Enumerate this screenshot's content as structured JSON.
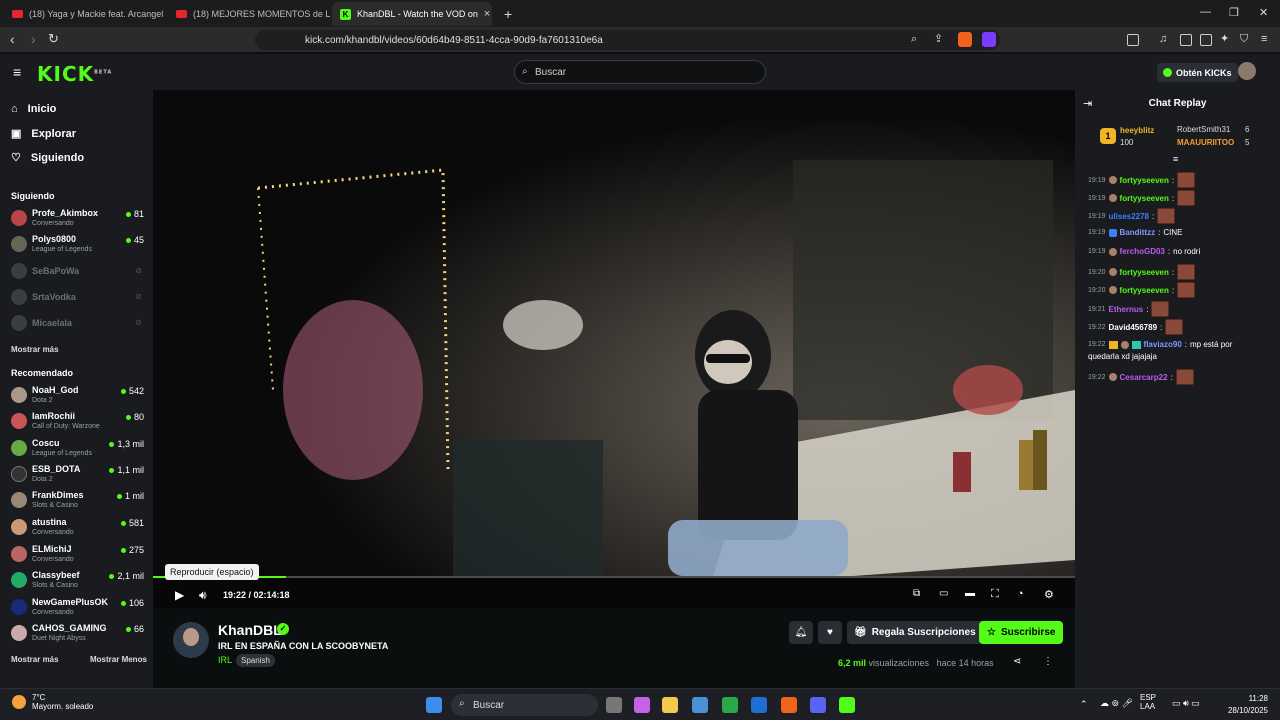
{
  "browser": {
    "tabs": [
      {
        "title": "(18) Yaga y Mackie feat. Arcangel y d",
        "active": false
      },
      {
        "title": "(18) MEJORES MOMENTOS de LA SC",
        "active": false
      },
      {
        "title": "KhanDBL - Watch the VOD on",
        "active": true
      }
    ],
    "url": "kick.com/khandbl/videos/60d64b49-8511-4cca-90d9-fa7601310e6a"
  },
  "header": {
    "logo": "KICK",
    "logo_beta": "BETA",
    "search_placeholder": "Buscar",
    "kicks_button": "Obtén KICKs"
  },
  "sidebar": {
    "nav": [
      {
        "label": "Inicio",
        "icon": "home-icon"
      },
      {
        "label": "Explorar",
        "icon": "compass-icon"
      },
      {
        "label": "Siguiendo",
        "icon": "heart-icon"
      }
    ],
    "following_title": "Siguiendo",
    "following": [
      {
        "name": "Profe_Akimbox",
        "category": "Conversando",
        "viewers": "81",
        "online": true
      },
      {
        "name": "Polys0800",
        "category": "League of Legends",
        "viewers": "45",
        "online": true
      },
      {
        "name": "SeBaPoWa",
        "online": false
      },
      {
        "name": "SrtaVodka",
        "online": false
      },
      {
        "name": "Micaelala",
        "online": false
      }
    ],
    "show_more": "Mostrar más",
    "recommended_title": "Recomendado",
    "recommended": [
      {
        "name": "NoaH_God",
        "category": "Dota 2",
        "viewers": "542"
      },
      {
        "name": "IamRochii",
        "category": "Call of Duty: Warzone",
        "viewers": "80"
      },
      {
        "name": "Coscu",
        "category": "League of Legends",
        "viewers": "1,3 mil"
      },
      {
        "name": "ESB_DOTA",
        "category": "Dota 2",
        "viewers": "1,1 mil"
      },
      {
        "name": "FrankDimes",
        "category": "Slots & Casino",
        "viewers": "1 mil"
      },
      {
        "name": "atustina",
        "category": "Conversando",
        "viewers": "581"
      },
      {
        "name": "ELMichiJ",
        "category": "Conversando",
        "viewers": "275"
      },
      {
        "name": "Classybeef",
        "category": "Slots & Casino",
        "viewers": "2,1 mil"
      },
      {
        "name": "NewGamePlusOK",
        "category": "Conversando",
        "viewers": "106"
      },
      {
        "name": "CAHOS_GAMING",
        "category": "Duet Night Abyss",
        "viewers": "66"
      }
    ],
    "show_more_2": "Mostrar más",
    "show_less": "Mostrar Menos"
  },
  "player": {
    "tooltip": "Reproducir (espacio)",
    "time": "19:22 / 02:14:18",
    "progress": 0.144
  },
  "stream": {
    "streamer": "KhanDBL",
    "title": "IRL EN ESPAÑA CON LA SCOOBYNETA",
    "category": "IRL",
    "language": "Spanish",
    "gift_button": "Regala Suscripciones",
    "subscribe_button": "Suscribirse",
    "views_count": "6,2 mil",
    "views_label": "visualizaciones",
    "time_ago": "hace 14 horas"
  },
  "chat": {
    "title": "Chat Replay",
    "top_gifter": {
      "rank": "1",
      "name": "heeyblitz",
      "amount": "100"
    },
    "gifters": [
      {
        "name": "RobertSmith31",
        "amount": "6"
      },
      {
        "name": "MAAUURIITOO",
        "amount": "5"
      }
    ],
    "messages": [
      {
        "time": "19:19",
        "user": "fortyyseeven",
        "text": "",
        "color": "#53fc18",
        "emote": true
      },
      {
        "time": "19:19",
        "user": "fortyyseeven",
        "text": "",
        "color": "#53fc18",
        "emote": true
      },
      {
        "time": "19:19",
        "user": "ulises2278",
        "text": "",
        "color": "#3b82f6",
        "emote": true
      },
      {
        "time": "19:19",
        "user": "Bandittzz",
        "text": "CINE",
        "color": "#7c9cff",
        "emote": false
      },
      {
        "time": "19:19",
        "user": "ferchoGD03",
        "text": "no rodri",
        "color": "#b65cf0",
        "emote": false
      },
      {
        "time": "19:20",
        "user": "fortyyseeven",
        "text": "",
        "color": "#53fc18",
        "emote": true
      },
      {
        "time": "19:20",
        "user": "fortyyseeven",
        "text": "",
        "color": "#53fc18",
        "emote": true
      },
      {
        "time": "19:21",
        "user": "Ethernus",
        "text": "",
        "color": "#b65cf0",
        "emote": true
      },
      {
        "time": "19:22",
        "user": "David456789",
        "text": "",
        "color": "#ffffff",
        "emote": true
      },
      {
        "time": "19:22",
        "user": "flaviazo90",
        "text": "mp está por",
        "text2": "quedarla xd jajajaja",
        "color": "#7c9cff",
        "emote": false
      },
      {
        "time": "19:22",
        "user": "Cesarcarp22",
        "text": "",
        "color": "#b65cf0",
        "emote": true
      }
    ]
  },
  "taskbar": {
    "weather_temp": "7°C",
    "weather_desc": "Mayorm. soleado",
    "search": "Buscar",
    "lang1": "ESP",
    "lang2": "LAA",
    "time": "11:28",
    "date": "28/10/2025"
  }
}
